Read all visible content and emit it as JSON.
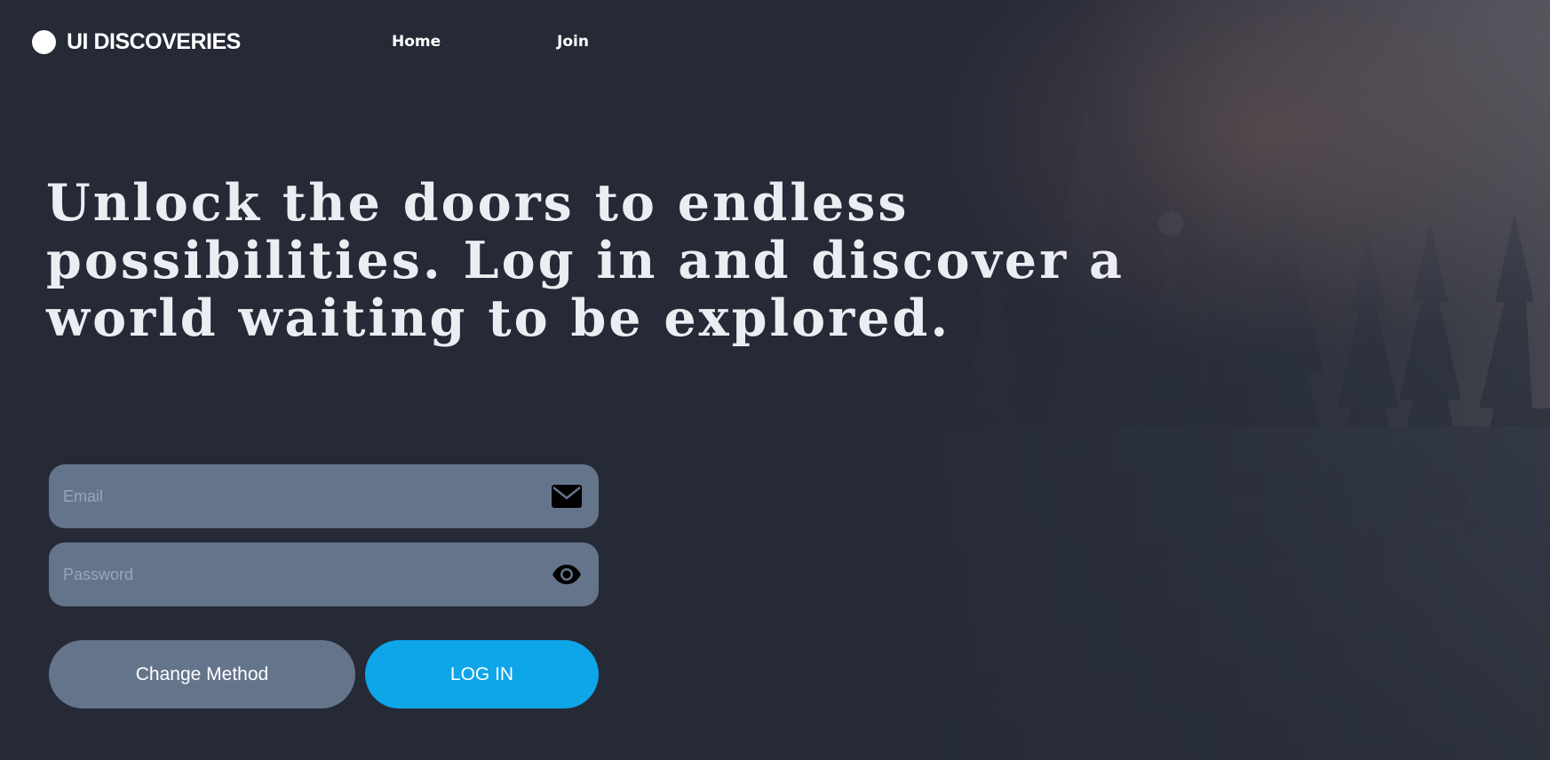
{
  "brand": {
    "name": "UI DISCOVERIES"
  },
  "nav": {
    "items": [
      {
        "label": "Home"
      },
      {
        "label": "Join"
      }
    ]
  },
  "hero": {
    "headline": "Unlock the doors to endless possibilities. Log in and discover a world waiting to be explored."
  },
  "form": {
    "email": {
      "placeholder": "Email",
      "value": "",
      "icon": "envelope-icon"
    },
    "password": {
      "placeholder": "Password",
      "value": "",
      "icon": "eye-icon"
    },
    "change_method_label": "Change Method",
    "login_label": "LOG IN"
  },
  "colors": {
    "background": "#262a37",
    "field": "#64748b",
    "primary": "#0ea5e9",
    "headline": "#ecedf2"
  }
}
